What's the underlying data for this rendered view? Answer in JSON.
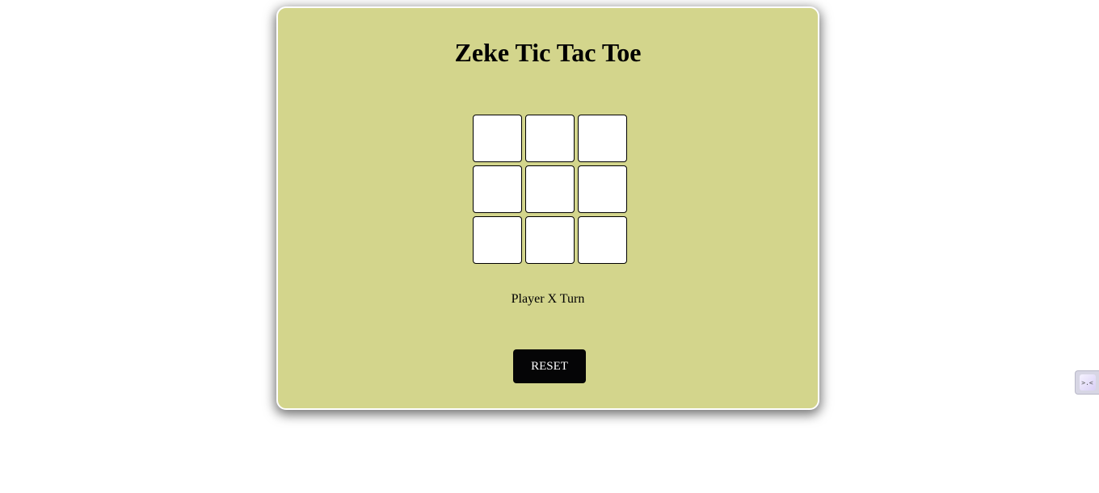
{
  "game": {
    "title": "Zeke Tic Tac Toe",
    "status": "Player X Turn",
    "reset_label": "RESET",
    "board": [
      "",
      "",
      "",
      "",
      "",
      "",
      "",
      "",
      ""
    ]
  },
  "colors": {
    "card_background": "#d3d58c",
    "reset_button_background": "#050506",
    "cell_background": "#ffffff"
  },
  "side_widget": {
    "icon": "extension-icon",
    "glyph": ">.<"
  }
}
